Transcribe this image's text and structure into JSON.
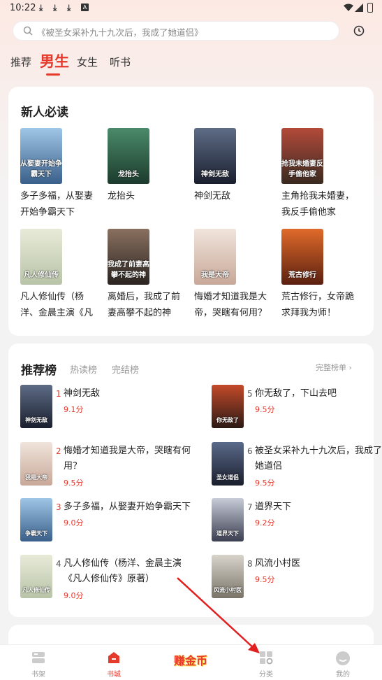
{
  "status_bar": {
    "time": "10:22",
    "icons": [
      "download-icon",
      "download-icon",
      "download-icon",
      "a-icon",
      "wifi-icon",
      "signal-icon",
      "battery-icon"
    ],
    "a_label": "A"
  },
  "search": {
    "placeholder": "《被圣女采补九十九次后，我成了她道侣》"
  },
  "tabs": [
    {
      "label": "推荐",
      "active": false
    },
    {
      "label": "男生",
      "active": true
    },
    {
      "label": "女生",
      "active": false
    },
    {
      "label": "听书",
      "active": false
    }
  ],
  "new_reader": {
    "title": "新人必读",
    "books": [
      {
        "name": "多子多福，从娶妻开始争霸天下",
        "cover_text": "从娶妻开始争霸天下",
        "colors": [
          "#9fc6e6",
          "#3a5f8a"
        ]
      },
      {
        "name": "龙抬头",
        "cover_text": "龙抬头",
        "colors": [
          "#4a8a6a",
          "#1c3b2c"
        ]
      },
      {
        "name": "神剑无敌",
        "cover_text": "神剑无敌",
        "colors": [
          "#5e6c86",
          "#1a1f2e"
        ]
      },
      {
        "name": "主角抢我未婚妻，我反手偷他家",
        "cover_text": "抢我未婚妻反手偷他家",
        "colors": [
          "#b34a3a",
          "#3a2a20"
        ]
      },
      {
        "name": "凡人修仙传（杨洋、金晨主演《凡人修仙传》原著）",
        "cover_text": "凡人修仙传",
        "colors": [
          "#e8ead8",
          "#b8c4a8"
        ]
      },
      {
        "name": "离婚后，我成了前妻高攀不起的神",
        "cover_text": "我成了前妻高攀不起的神",
        "colors": [
          "#8a7060",
          "#2a2420"
        ]
      },
      {
        "name": "悔婚才知道我是大帝，哭瞎有何用？",
        "cover_text": "我是大帝",
        "colors": [
          "#f0e4dc",
          "#c8a898"
        ]
      },
      {
        "name": "荒古修行，女帝跪求拜我为师！",
        "cover_text": "荒古修行",
        "colors": [
          "#e06a2a",
          "#5a2010"
        ]
      }
    ]
  },
  "ranking": {
    "title": "推荐榜",
    "subtabs": [
      "热读榜",
      "完结榜"
    ],
    "more_label": "完整榜单 ›",
    "items": [
      {
        "rank": "1",
        "name": "神剑无敌",
        "score": "9.1分",
        "cover_text": "神剑无敌",
        "colors": [
          "#5e6c86",
          "#1a1f2e"
        ]
      },
      {
        "rank": "2",
        "name": "悔婚才知道我是大帝，哭瞎有何用？",
        "score": "9.5分",
        "cover_text": "我是大帝",
        "colors": [
          "#f0e4dc",
          "#c8a898"
        ]
      },
      {
        "rank": "3",
        "name": "多子多福，从娶妻开始争霸天下",
        "score": "9.0分",
        "cover_text": "争霸天下",
        "colors": [
          "#9fc6e6",
          "#3a5f8a"
        ]
      },
      {
        "rank": "4",
        "name": "凡人修仙传（杨洋、金晨主演《凡人修仙传》原著）",
        "score": "9.0分",
        "cover_text": "凡人修仙传",
        "colors": [
          "#e8ead8",
          "#b8c4a8"
        ]
      },
      {
        "rank": "5",
        "name": "你无敌了，下山去吧",
        "score": "9.5分",
        "cover_text": "你无敌了",
        "colors": [
          "#c44a2a",
          "#2a1a14"
        ]
      },
      {
        "rank": "6",
        "name": "被圣女采补九十九次后，我成了她道侣",
        "score": "9.5分",
        "cover_text": "圣女道侣",
        "colors": [
          "#5a6a8a",
          "#1a1e2c"
        ]
      },
      {
        "rank": "7",
        "name": "道界天下",
        "score": "9.2分",
        "cover_text": "道界天下",
        "colors": [
          "#c8ccd8",
          "#3a3e50"
        ]
      },
      {
        "rank": "8",
        "name": "风流小村医",
        "score": "9.5分",
        "cover_text": "风流小村医",
        "colors": [
          "#d8d4cc",
          "#7a7468"
        ]
      }
    ]
  },
  "bottom_nav": {
    "items": [
      {
        "label": "书架",
        "icon": "bookshelf-icon",
        "active": false
      },
      {
        "label": "书城",
        "icon": "bookstore-icon",
        "active": true
      },
      {
        "label": "赚金币",
        "icon": "earn-coins-icon",
        "active": false
      },
      {
        "label": "分类",
        "icon": "category-icon",
        "active": false
      },
      {
        "label": "我的",
        "icon": "profile-icon",
        "active": false
      }
    ]
  },
  "colors": {
    "accent": "#e5392c",
    "annotation_arrow": "#e02020"
  }
}
